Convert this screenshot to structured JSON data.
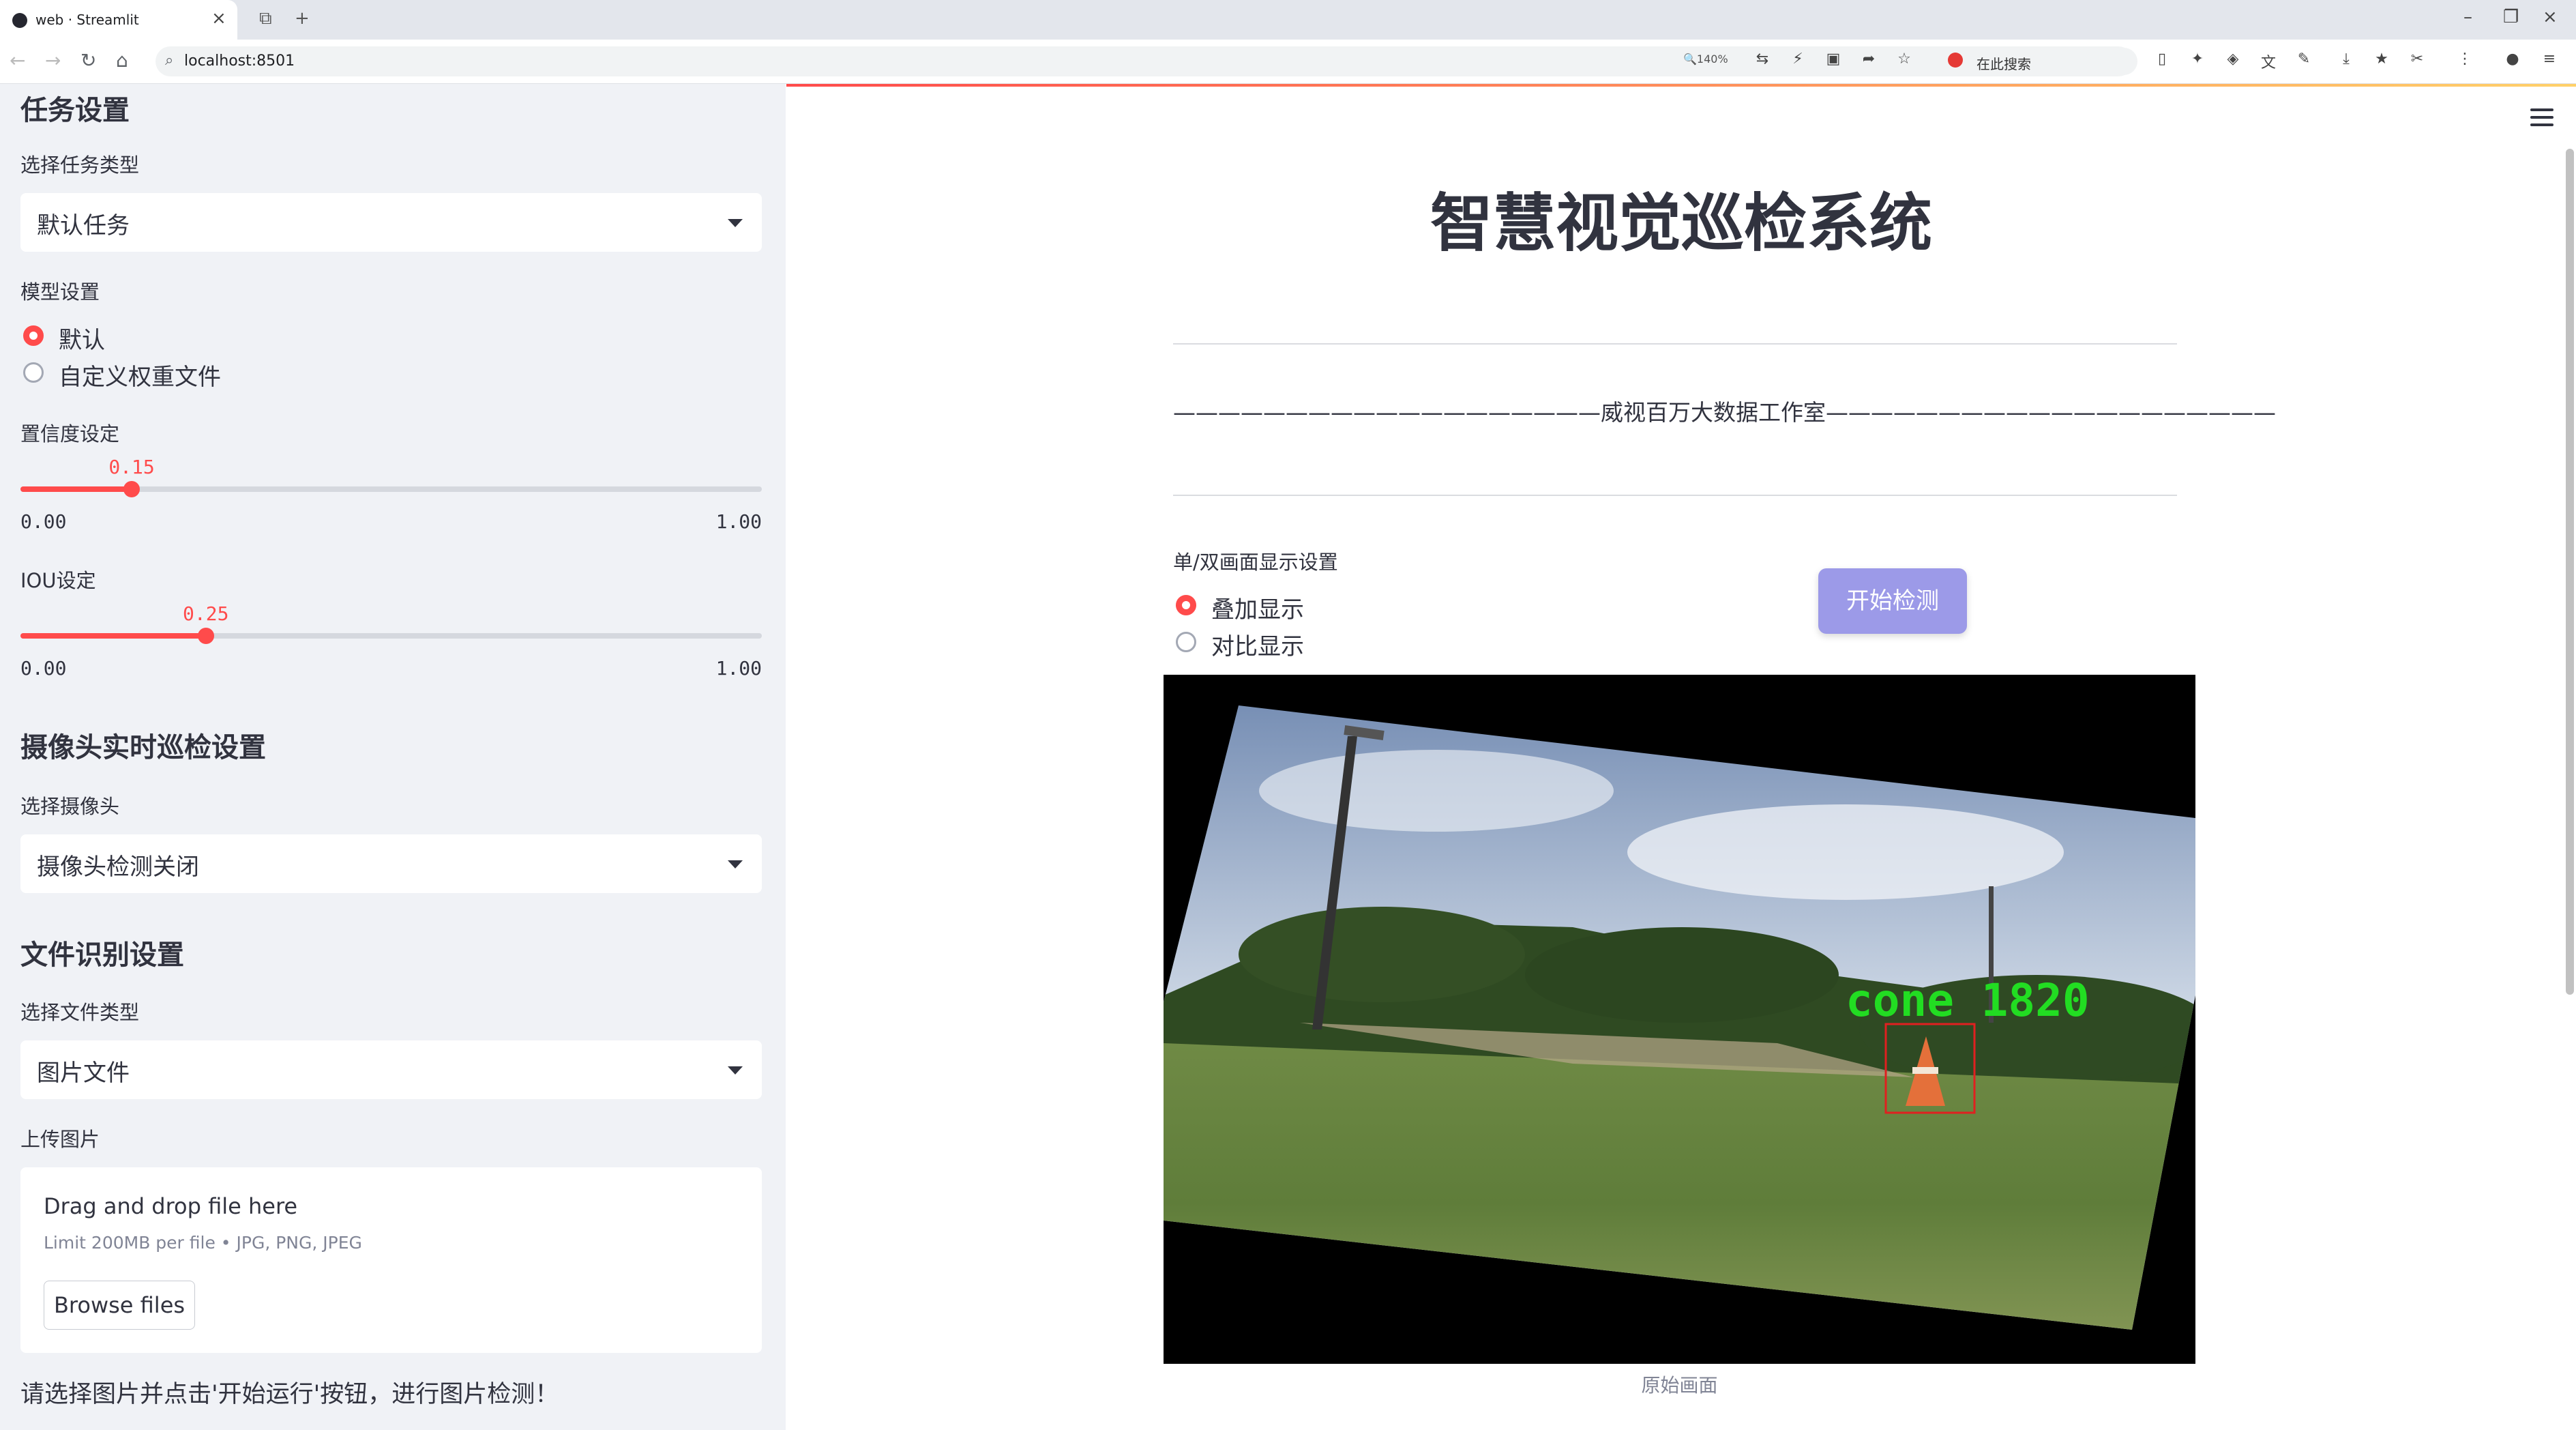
{
  "browser": {
    "tab_title": "web · Streamlit",
    "url": "localhost:8501",
    "zoom": "140%",
    "search_label": "在此搜索"
  },
  "sidebar": {
    "task_section": "任务设置",
    "task_type_label": "选择任务类型",
    "task_type_value": "默认任务",
    "model_label": "模型设置",
    "model_options": [
      "默认",
      "自定义权重文件"
    ],
    "model_selected": 0,
    "conf_label": "置信度设定",
    "conf_value": "0.15",
    "conf_fraction": 0.15,
    "iou_label": "IOU设定",
    "iou_value": "0.25",
    "iou_fraction": 0.25,
    "slider_min": "0.00",
    "slider_max": "1.00",
    "camera_section": "摄像头实时巡检设置",
    "camera_label": "选择摄像头",
    "camera_value": "摄像头检测关闭",
    "file_section": "文件识别设置",
    "file_type_label": "选择文件类型",
    "file_type_value": "图片文件",
    "upload_label": "上传图片",
    "upload_dd": "Drag and drop file here",
    "upload_limit": "Limit 200MB per file • JPG, PNG, JPEG",
    "browse_label": "Browse files",
    "hint": "请选择图片并点击'开始运行'按钮，进行图片检测！"
  },
  "main": {
    "title": "智慧视觉巡检系统",
    "studio_line": "———————————————————威视百万大数据工作室————————————————————",
    "display_label": "单/双画面显示设置",
    "display_options": [
      "叠加显示",
      "对比显示"
    ],
    "display_selected": 0,
    "start_button": "开始检测",
    "detection_label": "cone 1820",
    "image_caption": "原始画面"
  },
  "colors": {
    "accent": "#ff4b4b",
    "sidebar_bg": "#f0f2f6",
    "button_bg": "#9c9ae8",
    "detection_text": "#22dd22",
    "detection_box": "#e02020"
  }
}
